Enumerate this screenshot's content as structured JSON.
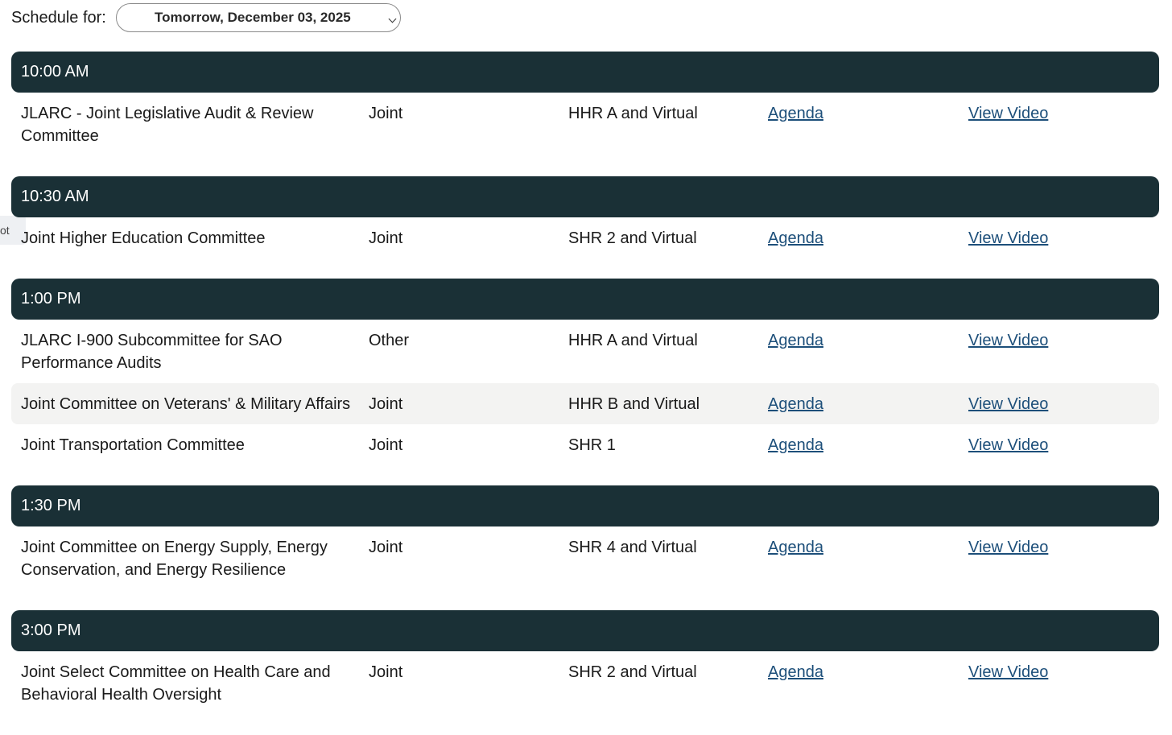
{
  "header": {
    "schedule_label": "Schedule for:",
    "date_selected": "Tomorrow, December 03, 2025"
  },
  "side_tab": {
    "label": "ot"
  },
  "groups": [
    {
      "time": "10:00 AM",
      "rows": [
        {
          "name": "JLARC - Joint Legislative Audit & Review Committee",
          "type": "Joint",
          "room": "HHR A and Virtual",
          "agenda": "Agenda",
          "video": "View Video"
        }
      ]
    },
    {
      "time": "10:30 AM",
      "rows": [
        {
          "name": "Joint Higher Education Committee",
          "type": "Joint",
          "room": "SHR 2 and Virtual",
          "agenda": "Agenda",
          "video": "View Video"
        }
      ]
    },
    {
      "time": "1:00 PM",
      "rows": [
        {
          "name": "JLARC I-900 Subcommittee for SAO Performance Audits",
          "type": "Other",
          "room": "HHR A and Virtual",
          "agenda": "Agenda",
          "video": "View Video"
        },
        {
          "name": "Joint Committee on Veterans' & Military Affairs",
          "type": "Joint",
          "room": "HHR B and Virtual",
          "agenda": "Agenda",
          "video": "View Video"
        },
        {
          "name": "Joint Transportation Committee",
          "type": "Joint",
          "room": "SHR 1",
          "agenda": "Agenda",
          "video": "View Video"
        }
      ]
    },
    {
      "time": "1:30 PM",
      "rows": [
        {
          "name": "Joint Committee on Energy Supply, Energy Conservation, and Energy Resilience",
          "type": "Joint",
          "room": "SHR 4 and Virtual",
          "agenda": "Agenda",
          "video": "View Video"
        }
      ]
    },
    {
      "time": "3:00 PM",
      "rows": [
        {
          "name": "Joint Select Committee on Health Care and Behavioral Health Oversight",
          "type": "Joint",
          "room": "SHR 2 and Virtual",
          "agenda": "Agenda",
          "video": "View Video"
        }
      ]
    }
  ],
  "colors": {
    "header_bg": "#1a3036",
    "link": "#1d4f7a",
    "shaded_row": "#f3f3f2"
  }
}
